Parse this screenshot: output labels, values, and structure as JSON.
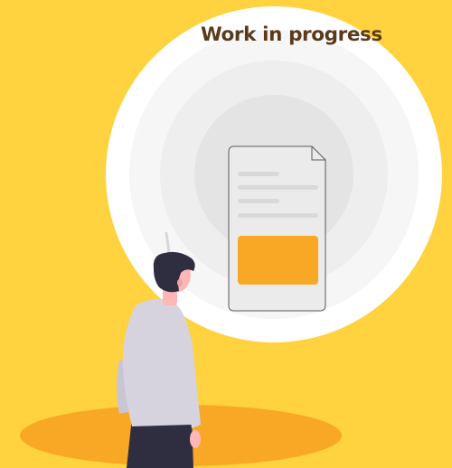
{
  "heading": {
    "text": "Work in progress"
  },
  "colors": {
    "background": "#FFD23F",
    "ground_ellipse": "#F9A825",
    "heading_text": "#5B3A1C",
    "circle_outer": "#FFFFFF",
    "circle_ring_2": "#F5F5F5",
    "circle_ring_3": "#EEEEEE",
    "circle_inner": "#E3E3E3",
    "document_card": "#EBEBEB",
    "document_line": "#D9D9D9",
    "document_block": "#F9A825",
    "person_hair": "#2F2E41",
    "person_skin": "#FFB6B6",
    "person_shirt": "#D6D3DE",
    "person_pants": "#2F2E41"
  },
  "icons": {
    "document": "document-icon",
    "person": "person-figure"
  }
}
